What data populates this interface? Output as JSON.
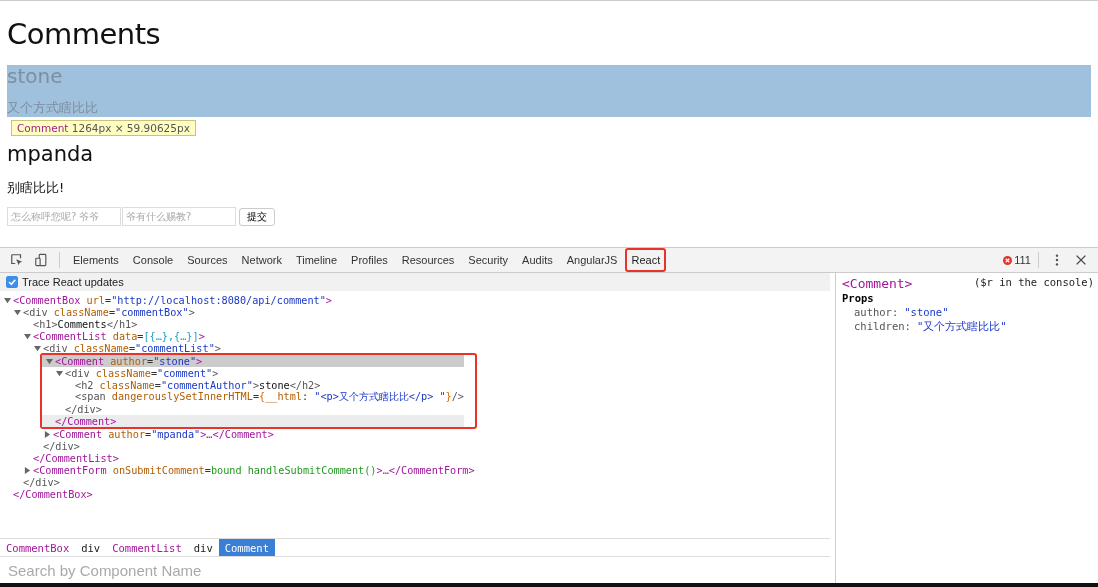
{
  "page": {
    "heading": "Comments",
    "comments": [
      {
        "author": "stone",
        "text": "又个方式瞎比比",
        "highlighted": true
      },
      {
        "author": "mpanda",
        "text": "别瞎比比!",
        "highlighted": false
      }
    ],
    "tooltip": {
      "name": "Comment",
      "size": "1264px × 59.90625px"
    },
    "form": {
      "name_placeholder": "怎么称呼您呢? 爷爷",
      "text_placeholder": "爷有什么赐教?",
      "submit": "提交"
    }
  },
  "devtools": {
    "tabs": [
      {
        "label": "Elements",
        "selected": false
      },
      {
        "label": "Console",
        "selected": false
      },
      {
        "label": "Sources",
        "selected": false
      },
      {
        "label": "Network",
        "selected": false
      },
      {
        "label": "Timeline",
        "selected": false
      },
      {
        "label": "Profiles",
        "selected": false
      },
      {
        "label": "Resources",
        "selected": false
      },
      {
        "label": "Security",
        "selected": false
      },
      {
        "label": "Audits",
        "selected": false
      },
      {
        "label": "AngularJS",
        "selected": false
      },
      {
        "label": "React",
        "selected": true
      }
    ],
    "error_count": "111",
    "trace": {
      "label": "Trace React updates",
      "checked": true
    },
    "tree": [
      {
        "expanded": true,
        "selected": false,
        "tokens": [
          {
            "kind": "tag",
            "t": "<CommentBox"
          },
          {
            "kind": "attr",
            "t": " url"
          },
          {
            "kind": "punct",
            "t": "="
          },
          {
            "kind": "str",
            "t": "\"http://localhost:8080/api/comment\""
          },
          {
            "kind": "tag",
            "t": ">"
          }
        ],
        "close": [
          {
            "kind": "tag",
            "t": "</CommentBox>"
          }
        ],
        "children": [
          {
            "expanded": true,
            "selected": false,
            "tokens": [
              {
                "kind": "dom",
                "t": "<div"
              },
              {
                "kind": "attr",
                "t": " className"
              },
              {
                "kind": "punct",
                "t": "="
              },
              {
                "kind": "str",
                "t": "\"commentBox\""
              },
              {
                "kind": "dom",
                "t": ">"
              }
            ],
            "close": [
              {
                "kind": "dom",
                "t": "</div>"
              }
            ],
            "children": [
              {
                "selected": false,
                "tokens": [
                  {
                    "kind": "dom",
                    "t": "<h1>"
                  },
                  {
                    "kind": "text",
                    "t": "Comments"
                  },
                  {
                    "kind": "dom",
                    "t": "</h1>"
                  }
                ]
              },
              {
                "expanded": true,
                "selected": false,
                "tokens": [
                  {
                    "kind": "tag",
                    "t": "<CommentList"
                  },
                  {
                    "kind": "attr",
                    "t": " data"
                  },
                  {
                    "kind": "punct",
                    "t": "="
                  },
                  {
                    "kind": "expr",
                    "t": "[{…},{…}]"
                  },
                  {
                    "kind": "tag",
                    "t": ">"
                  }
                ],
                "close": [
                  {
                    "kind": "tag",
                    "t": "</CommentList>"
                  }
                ],
                "children": [
                  {
                    "expanded": true,
                    "selected": false,
                    "tokens": [
                      {
                        "kind": "dom",
                        "t": "<div"
                      },
                      {
                        "kind": "attr",
                        "t": " className"
                      },
                      {
                        "kind": "punct",
                        "t": "="
                      },
                      {
                        "kind": "str",
                        "t": "\"commentList\""
                      },
                      {
                        "kind": "dom",
                        "t": ">"
                      }
                    ],
                    "close": [
                      {
                        "kind": "dom",
                        "t": "</div>"
                      }
                    ],
                    "children": [
                      {
                        "expanded": true,
                        "selected": true,
                        "tokens": [
                          {
                            "kind": "tag",
                            "t": "<Comment"
                          },
                          {
                            "kind": "attr",
                            "t": " author"
                          },
                          {
                            "kind": "punct",
                            "t": "="
                          },
                          {
                            "kind": "str",
                            "t": "\"stone\""
                          },
                          {
                            "kind": "tag",
                            "t": ">"
                          }
                        ],
                        "close": [
                          {
                            "kind": "tag",
                            "t": "</Comment>"
                          }
                        ],
                        "children": [
                          {
                            "expanded": true,
                            "selected": false,
                            "tokens": [
                              {
                                "kind": "dom",
                                "t": "<div"
                              },
                              {
                                "kind": "attr",
                                "t": " className"
                              },
                              {
                                "kind": "punct",
                                "t": "="
                              },
                              {
                                "kind": "str",
                                "t": "\"comment\""
                              },
                              {
                                "kind": "dom",
                                "t": ">"
                              }
                            ],
                            "close": [
                              {
                                "kind": "dom",
                                "t": "</div>"
                              }
                            ],
                            "children": [
                              {
                                "selected": false,
                                "tokens": [
                                  {
                                    "kind": "dom",
                                    "t": "<h2"
                                  },
                                  {
                                    "kind": "attr",
                                    "t": " className"
                                  },
                                  {
                                    "kind": "punct",
                                    "t": "="
                                  },
                                  {
                                    "kind": "str",
                                    "t": "\"commentAuthor\""
                                  },
                                  {
                                    "kind": "dom",
                                    "t": ">"
                                  },
                                  {
                                    "kind": "text",
                                    "t": "stone"
                                  },
                                  {
                                    "kind": "dom",
                                    "t": "</h2>"
                                  }
                                ]
                              },
                              {
                                "selected": false,
                                "tokens": [
                                  {
                                    "kind": "dom",
                                    "t": "<span"
                                  },
                                  {
                                    "kind": "attr",
                                    "t": " dangerouslySetInnerHTML"
                                  },
                                  {
                                    "kind": "punct",
                                    "t": "="
                                  },
                                  {
                                    "kind": "brace",
                                    "t": "{"
                                  },
                                  {
                                    "kind": "attr",
                                    "t": "__html"
                                  },
                                  {
                                    "kind": "punct",
                                    "t": ": "
                                  },
                                  {
                                    "kind": "str",
                                    "t": "\"<p>又个方式瞎比比</p> \""
                                  },
                                  {
                                    "kind": "brace",
                                    "t": "}"
                                  },
                                  {
                                    "kind": "dom",
                                    "t": "/>"
                                  }
                                ]
                              }
                            ]
                          }
                        ]
                      },
                      {
                        "expanded": false,
                        "selected": false,
                        "tokens": [
                          {
                            "kind": "tag",
                            "t": "<Comment"
                          },
                          {
                            "kind": "attr",
                            "t": " author"
                          },
                          {
                            "kind": "punct",
                            "t": "="
                          },
                          {
                            "kind": "str",
                            "t": "\"mpanda\""
                          },
                          {
                            "kind": "tag",
                            "t": ">…</Comment>"
                          }
                        ]
                      }
                    ]
                  }
                ]
              },
              {
                "expanded": false,
                "selected": false,
                "tokens": [
                  {
                    "kind": "tag",
                    "t": "<CommentForm"
                  },
                  {
                    "kind": "attr",
                    "t": " onSubmitComment"
                  },
                  {
                    "kind": "punct",
                    "t": "="
                  },
                  {
                    "kind": "fn",
                    "t": "bound handleSubmitComment()"
                  },
                  {
                    "kind": "tag",
                    "t": ">…</CommentForm>"
                  }
                ]
              }
            ]
          }
        ]
      }
    ],
    "breadcrumbs": [
      {
        "label": "CommentBox",
        "kind": "component",
        "selected": false
      },
      {
        "label": "div",
        "kind": "dom",
        "selected": false
      },
      {
        "label": "CommentList",
        "kind": "component",
        "selected": false
      },
      {
        "label": "div",
        "kind": "dom",
        "selected": false
      },
      {
        "label": "Comment",
        "kind": "component",
        "selected": true
      }
    ],
    "search": {
      "placeholder": "Search by Component Name"
    },
    "side": {
      "title": "<Comment>",
      "hint": "($r in the console)",
      "section": "Props",
      "props": [
        {
          "key": "author:",
          "value": "\"stone\""
        },
        {
          "key": "children:",
          "value": "\"又个方式瞎比比\""
        }
      ]
    }
  }
}
